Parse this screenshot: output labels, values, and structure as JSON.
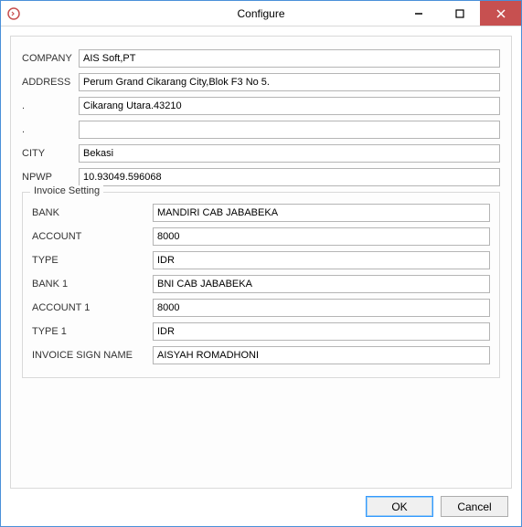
{
  "window": {
    "title": "Configure"
  },
  "form": {
    "company": {
      "label": "COMPANY",
      "value": "AIS Soft,PT"
    },
    "address": {
      "label": "ADDRESS",
      "value": "Perum Grand Cikarang City,Blok F3 No 5."
    },
    "address2": {
      "label": ".",
      "value": "Cikarang Utara.43210"
    },
    "address3": {
      "label": ".",
      "value": ""
    },
    "city": {
      "label": "CITY",
      "value": "Bekasi"
    },
    "npwp": {
      "label": "NPWP",
      "value": "10.93049.596068"
    }
  },
  "invoice": {
    "legend": "Invoice Setting",
    "bank": {
      "label": "BANK",
      "value": "MANDIRI CAB JABABEKA"
    },
    "account": {
      "label": "ACCOUNT",
      "value": "8000"
    },
    "type": {
      "label": "TYPE",
      "value": "IDR"
    },
    "bank1": {
      "label": "BANK 1",
      "value": "BNI CAB JABABEKA"
    },
    "account1": {
      "label": "ACCOUNT 1",
      "value": "8000"
    },
    "type1": {
      "label": "TYPE 1",
      "value": "IDR"
    },
    "sign": {
      "label": "INVOICE SIGN NAME",
      "value": "AISYAH ROMADHONI"
    }
  },
  "buttons": {
    "ok": "OK",
    "cancel": "Cancel"
  }
}
